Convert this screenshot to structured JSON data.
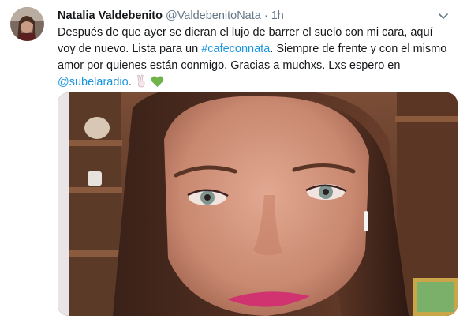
{
  "tweet": {
    "display_name": "Natalia Valdebenito",
    "handle": "@ValdebenitoNata",
    "separator": "·",
    "time": "1h",
    "text_part1": "Después de que ayer se dieran el lujo de barrer el suelo con mi cara, aquí voy de nuevo. Lista para un ",
    "hashtag": "#cafeconnata",
    "text_part2": ". Siempre de frente y con el mismo amor por quienes están conmigo. Gracias a muchxs. Lxs espero en ",
    "mention": "@subelaradio",
    "text_part3": ".",
    "emojis": [
      "victory-hand-emoji",
      "green-heart-emoji"
    ],
    "colors": {
      "link": "#1b95e0",
      "muted": "#657786",
      "text": "#14171a"
    }
  }
}
